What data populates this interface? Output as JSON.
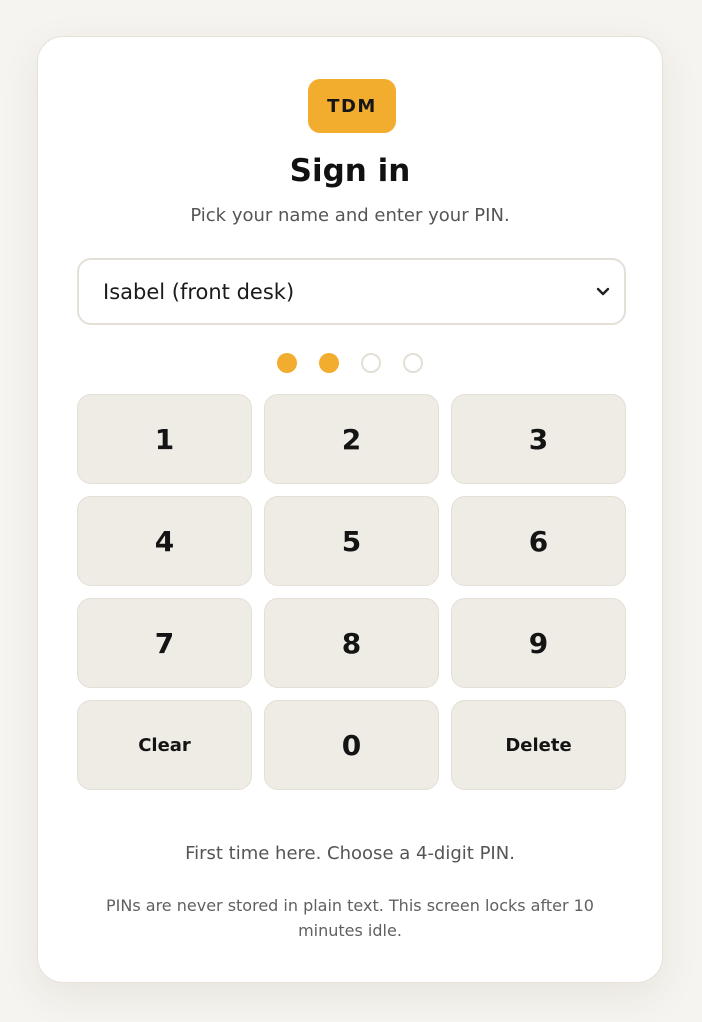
{
  "brand": {
    "logo_text": "TDM",
    "accent_color": "#f2ad2f"
  },
  "header": {
    "title": "Sign in",
    "subtitle": "Pick your name and enter your PIN."
  },
  "user_select": {
    "selected": "Isabel (front desk)",
    "icon": "chevron-down-icon"
  },
  "pin": {
    "length": 4,
    "entered": 2
  },
  "keypad": {
    "keys": [
      "1",
      "2",
      "3",
      "4",
      "5",
      "6",
      "7",
      "8",
      "9",
      "Clear",
      "0",
      "Delete"
    ]
  },
  "footer": {
    "hint": "First time here. Choose a 4-digit PIN.",
    "note": "PINs are never stored in plain text. This screen locks after 10 minutes idle."
  }
}
